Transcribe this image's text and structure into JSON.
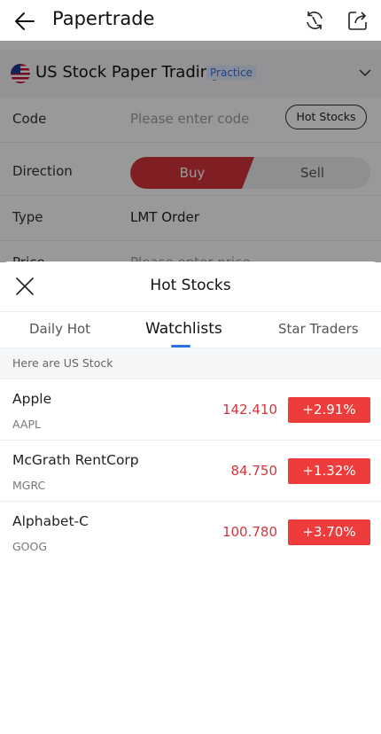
{
  "header": {
    "title": "Papertrade",
    "icons": [
      "back-arrow-icon",
      "refresh-icon",
      "share-icon"
    ]
  },
  "account": {
    "name": "US Stock Paper Trading",
    "badge": "Practice",
    "flag": "us-flag-icon"
  },
  "form": {
    "code_label": "Code",
    "code_placeholder": "Please enter code",
    "hot_stocks_button": "Hot Stocks",
    "direction_label": "Direction",
    "buy_label": "Buy",
    "sell_label": "Sell",
    "type_label": "Type",
    "type_value": "LMT Order",
    "price_label": "Price",
    "price_placeholder": "Please enter price"
  },
  "sheet": {
    "title": "Hot Stocks",
    "tabs": [
      {
        "label": "Daily Hot",
        "active": false
      },
      {
        "label": "Watchlists",
        "active": true
      },
      {
        "label": "Star Traders",
        "active": false
      }
    ],
    "hint": "Here are US Stock",
    "stocks": [
      {
        "name": "Apple",
        "ticker": "AAPL",
        "price": "142.410",
        "change": "+2.91%"
      },
      {
        "name": "McGrath RentCorp",
        "ticker": "MGRC",
        "price": "84.750",
        "change": "+1.32%"
      },
      {
        "name": "Alphabet-C",
        "ticker": "GOOG",
        "price": "100.780",
        "change": "+3.70%"
      }
    ]
  },
  "colors": {
    "up_red": "#ee3b3b",
    "price_red": "#d4353d",
    "accent_blue": "#2b6fe0"
  }
}
